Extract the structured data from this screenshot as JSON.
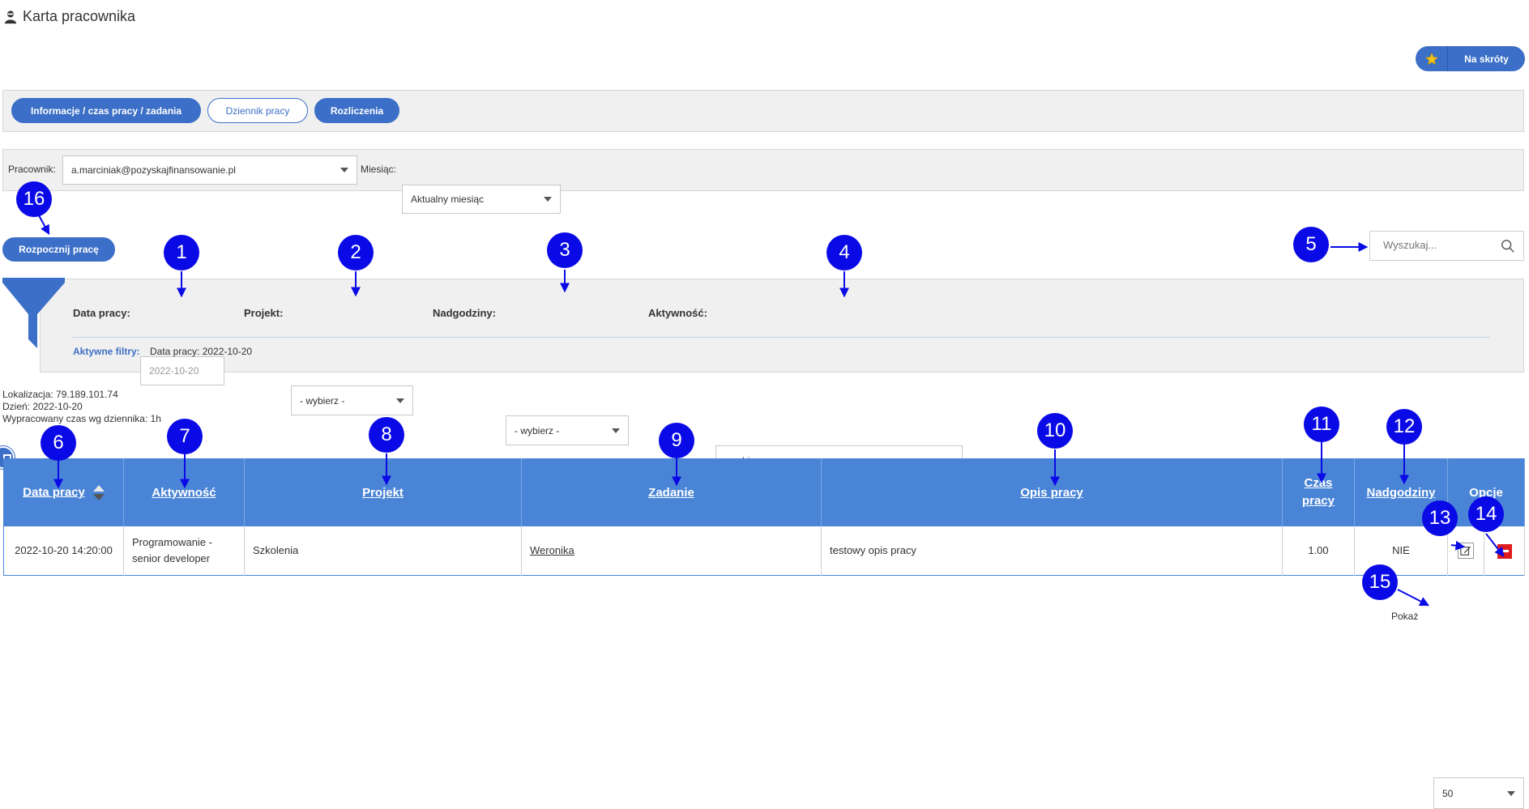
{
  "header": {
    "title": "Karta pracownika"
  },
  "shortcuts": {
    "label": "Na skróty"
  },
  "tabs": [
    {
      "label": "Informacje / czas pracy / zadania"
    },
    {
      "label": "Dziennik pracy"
    },
    {
      "label": "Rozliczenia"
    }
  ],
  "employee_filter": {
    "employee_label": "Pracownik:",
    "employee_value": "a.marciniak@pozyskajfinansowanie.pl",
    "month_label": "Miesiąc:",
    "month_value": "Aktualny miesiąc"
  },
  "start_button": {
    "label": "Rozpocznij pracę"
  },
  "search": {
    "placeholder": "Wyszukaj..."
  },
  "filters": {
    "date_label": "Data pracy:",
    "date_value": "2022-10-20",
    "project_label": "Projekt:",
    "project_value": "- wybierz -",
    "overtime_label": "Nadgodziny:",
    "overtime_value": "- wybierz -",
    "activity_label": "Aktywność:",
    "activity_value": "- wybierz -",
    "active_label": "Aktywne filtry:",
    "active_value": "Data pracy: 2022-10-20"
  },
  "info": {
    "location": "Lokalizacja: 79.189.101.74",
    "day": "Dzień: 2022-10-20",
    "worked": "Wypracowany czas wg dziennika: 1h"
  },
  "table": {
    "headers": {
      "date": "Data pracy",
      "activity": "Aktywność",
      "project": "Projekt",
      "task": "Zadanie",
      "description": "Opis pracy",
      "time": "Czas pracy",
      "overtime": "Nadgodziny",
      "options": "Opcje"
    },
    "rows": [
      {
        "date": "2022-10-20 14:20:00",
        "activity": "Programowanie - senior developer",
        "project": "Szkolenia",
        "task": "Weronika",
        "description": "testowy opis pracy",
        "time": "1.00",
        "overtime": "NIE"
      }
    ]
  },
  "pagination": {
    "show_label": "Pokaż",
    "show_value": "50"
  },
  "markers": [
    "1",
    "2",
    "3",
    "4",
    "5",
    "6",
    "7",
    "8",
    "9",
    "10",
    "11",
    "12",
    "13",
    "14",
    "15",
    "16"
  ],
  "colors": {
    "primary": "#3c6fc7",
    "table_header": "#4a84d6",
    "marker": "#0a0ae6",
    "delete": "#e01c1c"
  }
}
